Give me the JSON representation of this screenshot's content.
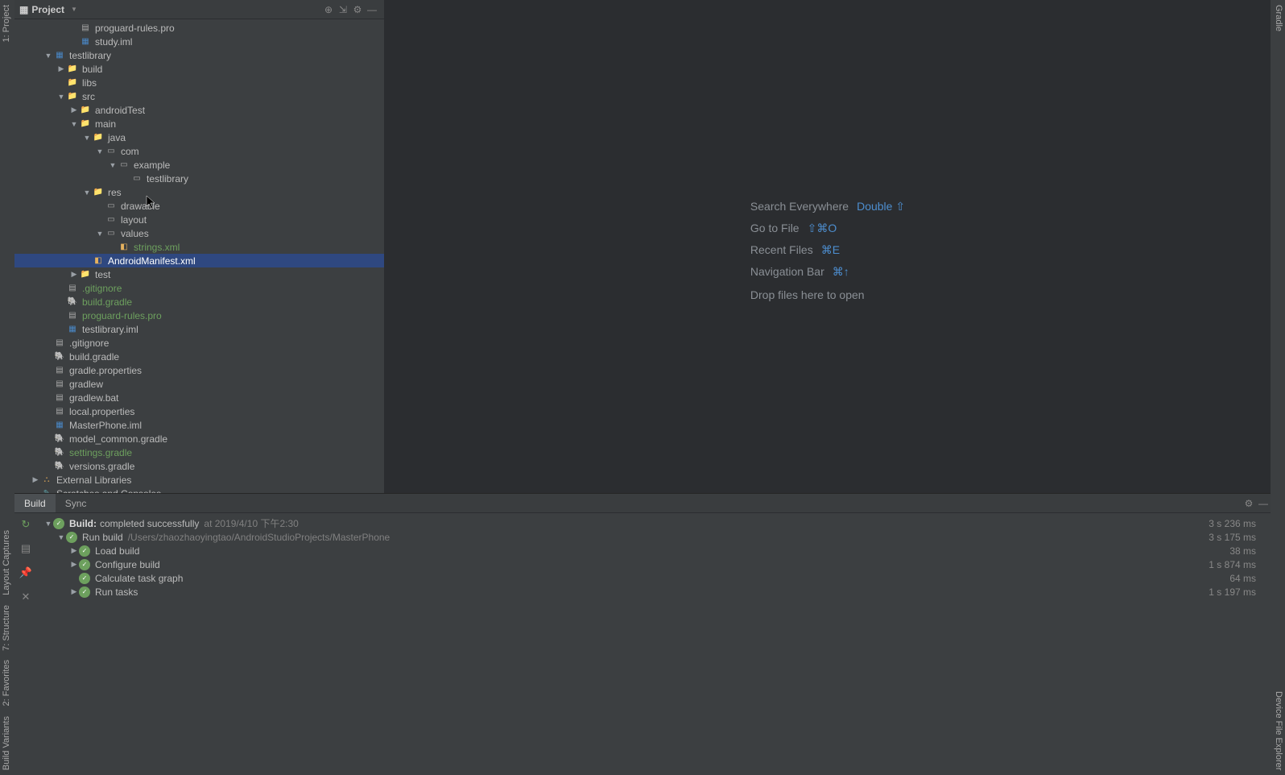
{
  "leftGutter": [
    "1: Project",
    "Layout Captures",
    "7: Structure",
    "2: Favorites",
    "Build Variants"
  ],
  "rightGutter": [
    "Gradle",
    "Device File Explorer"
  ],
  "panel": {
    "title": "Project"
  },
  "tree": [
    {
      "d": 3,
      "a": "b",
      "i": "file",
      "t": "proguard-rules.pro",
      "c": ""
    },
    {
      "d": 3,
      "a": "b",
      "i": "mod",
      "t": "study.iml",
      "c": ""
    },
    {
      "d": 1,
      "a": "v",
      "i": "mod",
      "t": "testlibrary",
      "c": ""
    },
    {
      "d": 2,
      "a": ">",
      "i": "folder",
      "t": "build",
      "c": ""
    },
    {
      "d": 2,
      "a": "b",
      "i": "folder",
      "t": "libs",
      "c": ""
    },
    {
      "d": 2,
      "a": "v",
      "i": "folder",
      "t": "src",
      "c": ""
    },
    {
      "d": 3,
      "a": ">",
      "i": "folder",
      "t": "androidTest",
      "c": ""
    },
    {
      "d": 3,
      "a": "v",
      "i": "folder",
      "t": "main",
      "c": ""
    },
    {
      "d": 4,
      "a": "v",
      "i": "folder blue",
      "t": "java",
      "c": ""
    },
    {
      "d": 5,
      "a": "v",
      "i": "folder pkg",
      "t": "com",
      "c": ""
    },
    {
      "d": 6,
      "a": "v",
      "i": "folder pkg",
      "t": "example",
      "c": ""
    },
    {
      "d": 7,
      "a": "b",
      "i": "folder pkg",
      "t": "testlibrary",
      "c": ""
    },
    {
      "d": 4,
      "a": "v",
      "i": "folder orange",
      "t": "res",
      "c": ""
    },
    {
      "d": 5,
      "a": "b",
      "i": "folder pkg",
      "t": "drawable",
      "c": ""
    },
    {
      "d": 5,
      "a": "b",
      "i": "folder pkg",
      "t": "layout",
      "c": ""
    },
    {
      "d": 5,
      "a": "v",
      "i": "folder pkg",
      "t": "values",
      "c": ""
    },
    {
      "d": 6,
      "a": "b",
      "i": "xml",
      "t": "strings.xml",
      "c": "green"
    },
    {
      "d": 4,
      "a": "b",
      "i": "xml",
      "t": "AndroidManifest.xml",
      "c": "",
      "sel": true
    },
    {
      "d": 3,
      "a": ">",
      "i": "folder",
      "t": "test",
      "c": ""
    },
    {
      "d": 2,
      "a": "b",
      "i": "file",
      "t": ".gitignore",
      "c": "green"
    },
    {
      "d": 2,
      "a": "b",
      "i": "gradle",
      "t": "build.gradle",
      "c": "green"
    },
    {
      "d": 2,
      "a": "b",
      "i": "file",
      "t": "proguard-rules.pro",
      "c": "green"
    },
    {
      "d": 2,
      "a": "b",
      "i": "mod",
      "t": "testlibrary.iml",
      "c": ""
    },
    {
      "d": 1,
      "a": "b",
      "i": "file",
      "t": ".gitignore",
      "c": ""
    },
    {
      "d": 1,
      "a": "b",
      "i": "gradle",
      "t": "build.gradle",
      "c": ""
    },
    {
      "d": 1,
      "a": "b",
      "i": "file",
      "t": "gradle.properties",
      "c": ""
    },
    {
      "d": 1,
      "a": "b",
      "i": "file",
      "t": "gradlew",
      "c": ""
    },
    {
      "d": 1,
      "a": "b",
      "i": "file",
      "t": "gradlew.bat",
      "c": ""
    },
    {
      "d": 1,
      "a": "b",
      "i": "file",
      "t": "local.properties",
      "c": ""
    },
    {
      "d": 1,
      "a": "b",
      "i": "mod",
      "t": "MasterPhone.iml",
      "c": ""
    },
    {
      "d": 1,
      "a": "b",
      "i": "gradle",
      "t": "model_common.gradle",
      "c": ""
    },
    {
      "d": 1,
      "a": "b",
      "i": "gradle",
      "t": "settings.gradle",
      "c": "green"
    },
    {
      "d": 1,
      "a": "b",
      "i": "gradle",
      "t": "versions.gradle",
      "c": ""
    },
    {
      "d": 0,
      "a": ">",
      "i": "lib",
      "t": "External Libraries",
      "c": ""
    },
    {
      "d": 0,
      "a": "b",
      "i": "scr",
      "t": "Scratches and Consoles",
      "c": ""
    }
  ],
  "welcome": {
    "rows": [
      {
        "l": "Search Everywhere",
        "k": "Double ⇧"
      },
      {
        "l": "Go to File",
        "k": "⇧⌘O"
      },
      {
        "l": "Recent Files",
        "k": "⌘E"
      },
      {
        "l": "Navigation Bar",
        "k": "⌘↑"
      }
    ],
    "drop": "Drop files here to open"
  },
  "buildTabs": [
    "Build",
    "Sync"
  ],
  "build": [
    {
      "d": 0,
      "a": "v",
      "dot": true,
      "b": true,
      "t": "Build:",
      "suf": "completed successfully",
      "path": "at 2019/4/10 下午2:30",
      "time": "3 s 236 ms"
    },
    {
      "d": 1,
      "a": "v",
      "dot": true,
      "t": "Run build",
      "path": "/Users/zhaozhaoyingtao/AndroidStudioProjects/MasterPhone",
      "time": "3 s 175 ms"
    },
    {
      "d": 2,
      "a": ">",
      "dot": true,
      "t": "Load build",
      "time": "38 ms"
    },
    {
      "d": 2,
      "a": ">",
      "dot": true,
      "t": "Configure build",
      "time": "1 s 874 ms"
    },
    {
      "d": 2,
      "a": "b",
      "dot": true,
      "t": "Calculate task graph",
      "time": "64 ms"
    },
    {
      "d": 2,
      "a": ">",
      "dot": true,
      "t": "Run tasks",
      "time": "1 s 197 ms"
    }
  ]
}
